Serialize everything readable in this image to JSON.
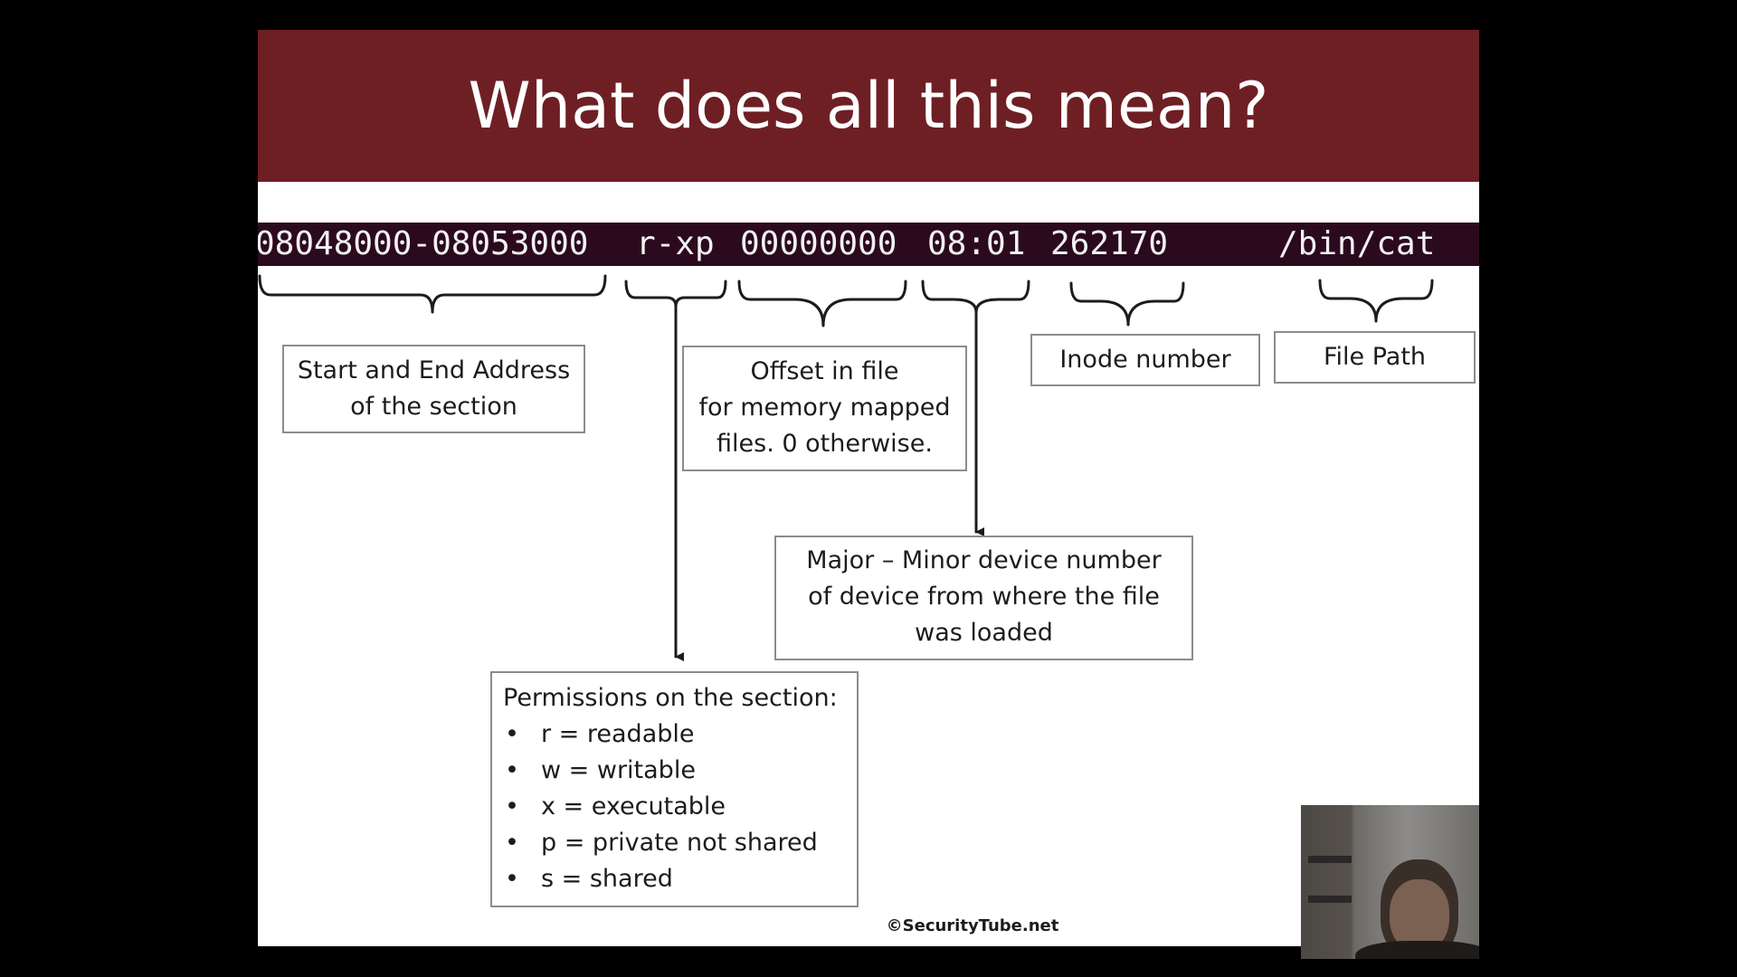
{
  "slide": {
    "title": "What does all this mean?",
    "terminal_line": {
      "address_range": "08048000-08053000",
      "permissions": "r-xp",
      "offset": "00000000",
      "device": "08:01",
      "inode": "262170",
      "path": "/bin/cat"
    },
    "labels": {
      "address": [
        "Start and End Address",
        "of the section"
      ],
      "offset": [
        "Offset in file",
        "for memory mapped",
        "files. 0 otherwise."
      ],
      "inode": "Inode number",
      "file_path": "File Path",
      "device": [
        "Major – Minor device number",
        "of device from where the file",
        "was loaded"
      ],
      "permissions_heading": "Permissions on the section:",
      "permissions_items": [
        "r = readable",
        "w = writable",
        "x = executable",
        "p = private not shared",
        "s = shared"
      ]
    },
    "footer": "©SecurityTube.net"
  },
  "colors": {
    "title_bar": "#6e1f24",
    "terminal_bg": "#2c0a1e",
    "terminal_text": "#f2f2f2",
    "box_border": "#8c8c8c"
  },
  "icons": [
    "bullet-icon",
    "down-arrow-icon",
    "curly-brace-icon"
  ]
}
